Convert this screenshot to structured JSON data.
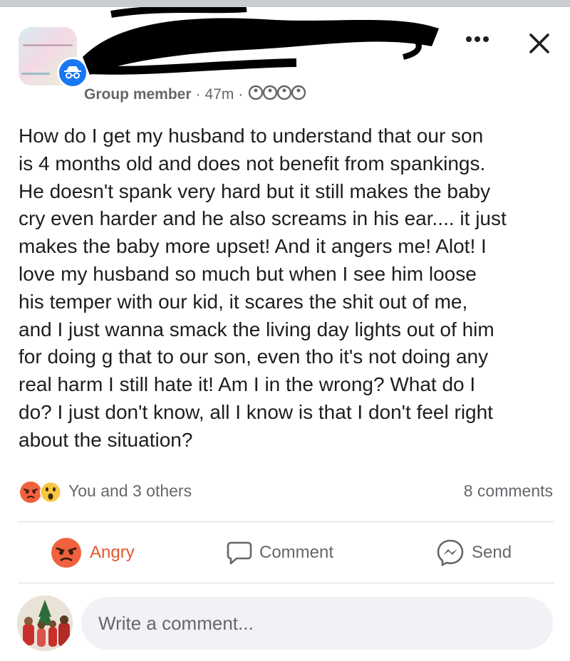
{
  "post": {
    "author_role": "Group member",
    "time": "47m",
    "audience_icon": "group-audience-icon",
    "text": "How do I get my husband to understand that our son\nis 4 months old and does not benefit from spankings.\nHe doesn't spank very hard but it still makes the baby\ncry even harder and he also screams in his ear.... it just\nmakes the baby more upset! And it angers me! Alot! I\nlove my husband so much but when I see him loose\nhis temper with our kid, it scares the shit out of me,\nand I just wanna smack the living day lights out of him\nfor doing g that to our son, even tho it's not doing any\nreal harm I still hate it! Am I in the wrong? What do I\ndo? I just don't know, all I know is that I don't feel right\nabout the situation?"
  },
  "header": {
    "more_icon": "more-options-icon",
    "close_icon": "close-icon"
  },
  "reactions": {
    "icons": [
      "angry-reaction-icon",
      "wow-reaction-icon"
    ],
    "summary": "You and 3 others",
    "comments": "8 comments"
  },
  "actions": {
    "react_label": "Angry",
    "comment_label": "Comment",
    "send_label": "Send"
  },
  "composer": {
    "placeholder": "Write a comment..."
  },
  "colors": {
    "angry": "#e4572e",
    "facebook_blue": "#1877f2",
    "secondary_text": "#65676b"
  }
}
